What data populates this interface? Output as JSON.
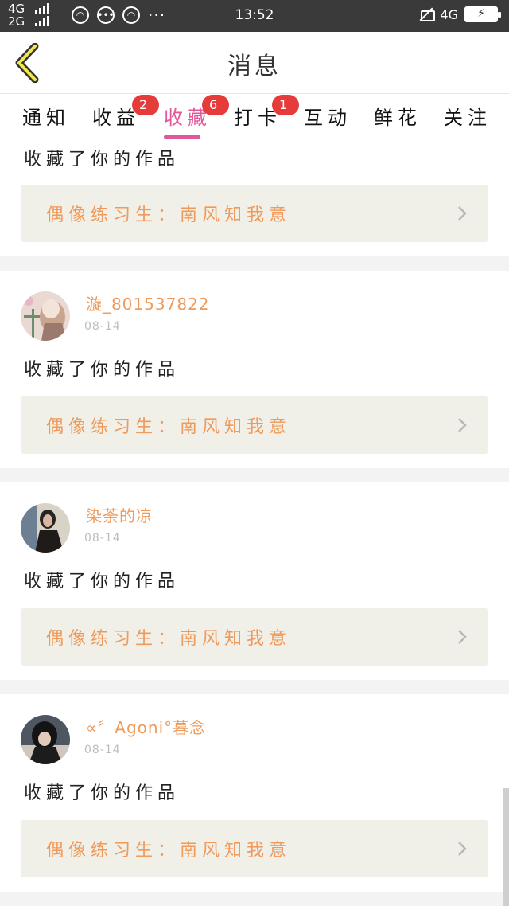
{
  "status_bar": {
    "net_top": "4G",
    "net_bottom": "2G",
    "time": "13:52",
    "net_right": "4G",
    "more": "···"
  },
  "header": {
    "title": "消息",
    "back_icon": "chevron-left-icon"
  },
  "tabs": [
    {
      "label": "通知",
      "badge": ""
    },
    {
      "label": "收益",
      "badge": "2"
    },
    {
      "label": "收藏",
      "badge": "6",
      "active": true
    },
    {
      "label": "打卡",
      "badge": "1"
    },
    {
      "label": "互动",
      "badge": ""
    },
    {
      "label": "鲜花",
      "badge": ""
    },
    {
      "label": "关注",
      "badge": ""
    }
  ],
  "colors": {
    "accent": "#e2569a",
    "badge": "#e53b3b",
    "orange_text": "#ef9a5b",
    "work_bg": "#f0f0e8"
  },
  "partial_item": {
    "message": "收藏了你的作品",
    "work_title": "偶像练习生：南风知我意"
  },
  "items": [
    {
      "username": "漩_801537822",
      "date": "08-14",
      "message": "收藏了你的作品",
      "work_title": "偶像练习生：南风知我意"
    },
    {
      "username": "染荼的凉",
      "date": "08-14",
      "message": "收藏了你的作品",
      "work_title": "偶像练习生：南风知我意"
    },
    {
      "username": "∝〞Agoni°暮念",
      "date": "08-14",
      "message": "收藏了你的作品",
      "work_title": "偶像练习生：南风知我意"
    }
  ]
}
